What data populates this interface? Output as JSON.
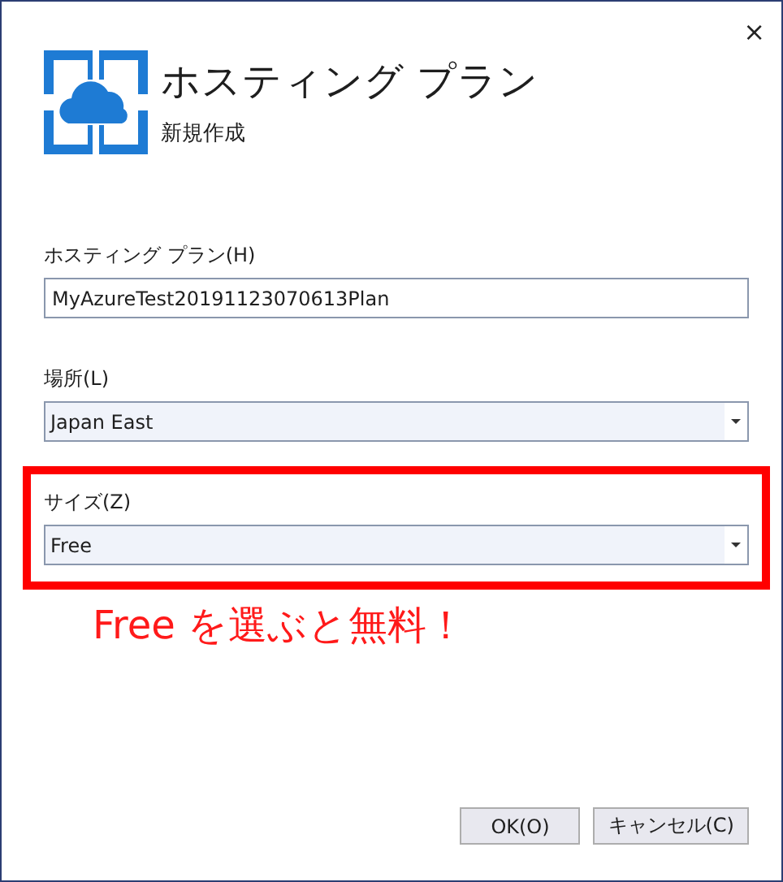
{
  "window": {
    "close_glyph": "×"
  },
  "header": {
    "title": "ホスティング プラン",
    "subtitle": "新規作成"
  },
  "fields": [
    {
      "label": "ホスティング プラン(H)",
      "kind": "text",
      "value": "MyAzureTest20191123070613Plan",
      "highlighted": false
    },
    {
      "label": "場所(L)",
      "kind": "dropdown",
      "value": "Japan East",
      "highlighted": false
    },
    {
      "label": "サイズ(Z)",
      "kind": "dropdown",
      "value": "Free",
      "highlighted": true
    }
  ],
  "annotation": "Free を選ぶと無料！",
  "buttons": [
    "OK(O)",
    "キャンセル(C)"
  ]
}
